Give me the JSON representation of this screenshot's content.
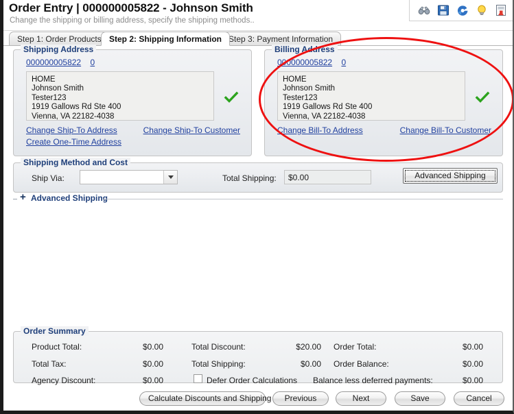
{
  "header": {
    "title": "Order Entry | 000000005822 - Johnson Smith",
    "subtitle": "Change the shipping or billing address, specify the shipping methods..",
    "toolbar": [
      {
        "name": "binoculars-icon",
        "label": "Search"
      },
      {
        "name": "save-icon",
        "label": "Save"
      },
      {
        "name": "refresh-icon",
        "label": "Refresh"
      },
      {
        "name": "lightbulb-icon",
        "label": "Hints"
      },
      {
        "name": "report-icon",
        "label": "Report"
      }
    ]
  },
  "tabs": [
    {
      "label": "Step 1: Order Products",
      "active": false
    },
    {
      "label": "Step 2: Shipping Information",
      "active": true
    },
    {
      "label": "Step 3: Payment Information",
      "active": false
    }
  ],
  "shipping_address": {
    "group_title": "Shipping Address",
    "account_link": "000000005822",
    "sequence_link": "0",
    "address_lines": "HOME\nJohnson Smith\nTester123\n1919 Gallows Rd Ste 400\nVienna, VA 22182-4038",
    "valid_icon": "green-check-icon",
    "change_address_link": "Change Ship-To Address",
    "change_customer_link": "Change Ship-To Customer",
    "create_onetime_link": "Create One-Time Address"
  },
  "billing_address": {
    "group_title": "Billing Address",
    "account_link": "000000005822",
    "sequence_link": "0",
    "address_lines": "HOME\nJohnson Smith\nTester123\n1919 Gallows Rd Ste 400\nVienna, VA 22182-4038",
    "valid_icon": "green-check-icon",
    "change_address_link": "Change Bill-To Address",
    "change_customer_link": "Change Bill-To Customer"
  },
  "shipping_method": {
    "group_title": "Shipping Method and Cost",
    "ship_via_label": "Ship Via:",
    "ship_via_value": "",
    "total_shipping_label": "Total Shipping:",
    "total_shipping_value": "$0.00",
    "advanced_shipping_button": "Advanced Shipping"
  },
  "advanced_shipping_expander": {
    "toggle": "+",
    "label": "Advanced Shipping",
    "expanded": false
  },
  "order_summary": {
    "group_title": "Order Summary",
    "rows": [
      {
        "label": "Product Total:",
        "value": "$0.00"
      },
      {
        "label": "Total Tax:",
        "value": "$0.00"
      },
      {
        "label": "Agency Discount:",
        "value": "$0.00"
      }
    ],
    "rows_mid": [
      {
        "label": "Total Discount:",
        "value": "$20.00"
      },
      {
        "label": "Total Shipping:",
        "value": "$0.00"
      }
    ],
    "rows_right": [
      {
        "label": "Order Total:",
        "value": "$0.00"
      },
      {
        "label": "Order Balance:",
        "value": "$0.00"
      }
    ],
    "defer_checkbox_label": "Defer Order Calculations",
    "defer_checked": false,
    "balance_less_label": "Balance less deferred payments:",
    "balance_less_value": "$0.00"
  },
  "footer_buttons": [
    {
      "label": "Calculate Discounts and Shipping"
    },
    {
      "label": "Previous"
    },
    {
      "label": "Next"
    },
    {
      "label": "Save"
    },
    {
      "label": "Cancel"
    }
  ],
  "annotation": {
    "shape": "red-oval-highlight",
    "color": "#ee1111"
  }
}
